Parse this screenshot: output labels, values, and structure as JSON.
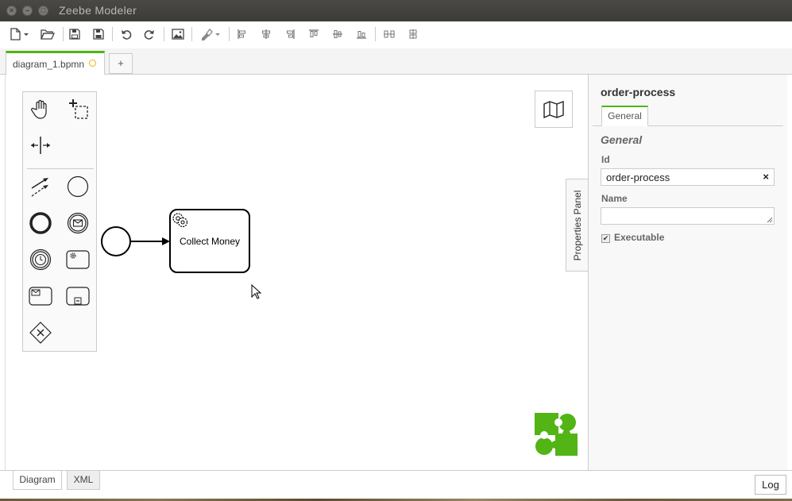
{
  "window": {
    "title": "Zeebe Modeler",
    "close_glyph": "×",
    "minimize_glyph": "–",
    "maximize_glyph": "□"
  },
  "toolbar": {
    "buttons": [
      "new-file-icon",
      "open-folder-icon",
      "save-icon",
      "save-as-icon",
      "undo-icon",
      "redo-icon",
      "export-image-icon",
      "color-picker-icon",
      "align-left-icon",
      "align-center-icon",
      "align-right-icon",
      "align-top-icon",
      "align-middle-icon",
      "align-bottom-icon",
      "distribute-horizontal-icon",
      "distribute-vertical-icon"
    ]
  },
  "tabs": {
    "active_label": "diagram_1.bpmn",
    "add_label": "+"
  },
  "diagram": {
    "task_label": "Collect Money",
    "properties_toggle_label": "Properties Panel"
  },
  "properties": {
    "title": "order-process",
    "tab_label": "General",
    "group_title": "General",
    "id_label": "Id",
    "id_value": "order-process",
    "clear_glyph": "×",
    "name_label": "Name",
    "name_value": "",
    "executable_label": "Executable",
    "executable_checked": true,
    "check_glyph": "✔"
  },
  "bottom": {
    "tab_diagram": "Diagram",
    "tab_xml": "XML",
    "log_label": "Log"
  },
  "colors": {
    "accent": "#52b415",
    "dirty_indicator": "#f0b400",
    "titlebar": "#3c3b37"
  }
}
